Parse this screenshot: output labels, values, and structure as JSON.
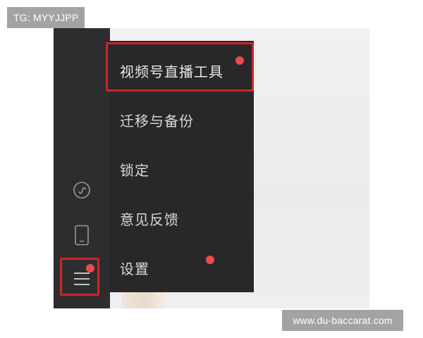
{
  "watermarks": {
    "top_left": "TG: MYYJJPP",
    "bottom_right": "www.du-baccarat.com"
  },
  "sidebar": {
    "icons": [
      {
        "name": "mini-program-icon",
        "active": false
      },
      {
        "name": "phone-icon",
        "active": false
      },
      {
        "name": "menu-icon",
        "active": true,
        "has_badge": true
      }
    ]
  },
  "menu": {
    "items": [
      {
        "label": "视频号直播工具",
        "has_badge": true,
        "highlighted": true
      },
      {
        "label": "迁移与备份",
        "has_badge": false
      },
      {
        "label": "锁定",
        "has_badge": false
      },
      {
        "label": "意见反馈",
        "has_badge": false
      },
      {
        "label": "设置",
        "has_badge": true
      }
    ]
  },
  "colors": {
    "sidebar_bg": "#2d2d30",
    "menu_bg": "#28282b",
    "highlight": "#d12323",
    "badge": "#f04a4a",
    "watermark_bg": "#a3a3a3"
  }
}
